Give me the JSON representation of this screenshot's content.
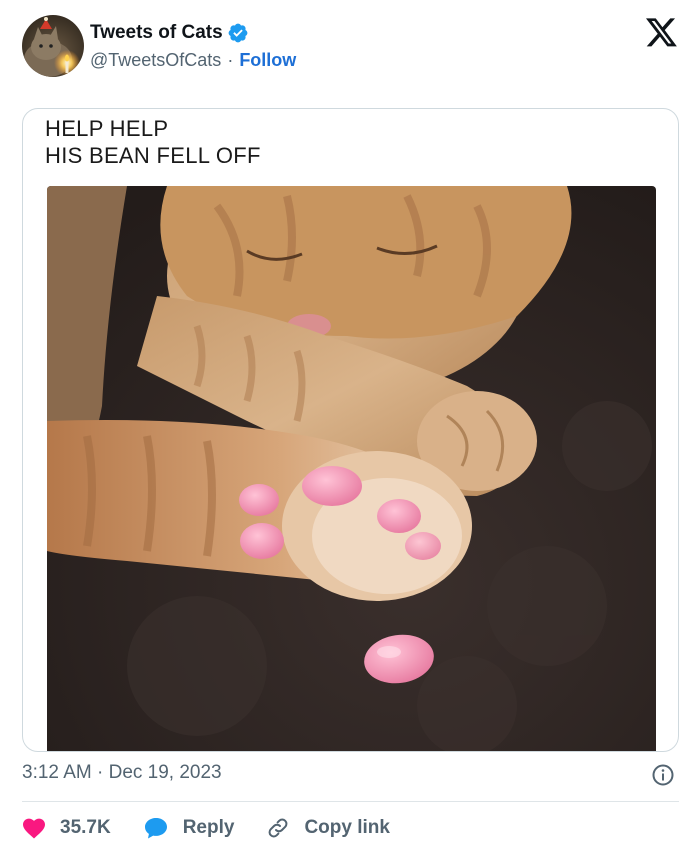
{
  "account": {
    "display_name": "Tweets of Cats",
    "handle": "@TweetsOfCats",
    "separator": "·",
    "follow_label": "Follow",
    "verified": true
  },
  "media": {
    "caption_line1": "HELP HELP",
    "caption_line2": "HIS BEAN FELL OFF"
  },
  "footer": {
    "timestamp": "3:12 AM · Dec 19, 2023"
  },
  "actions": {
    "likes": "35.7K",
    "reply_label": "Reply",
    "copy_label": "Copy link"
  },
  "colors": {
    "accent": "#1d9bf0",
    "follow": "#1d6fd6",
    "like": "#f91880",
    "muted": "#536471"
  },
  "icons": [
    "verified-badge-icon",
    "x-logo-icon",
    "info-icon",
    "heart-icon",
    "reply-bubble-icon",
    "link-icon"
  ]
}
